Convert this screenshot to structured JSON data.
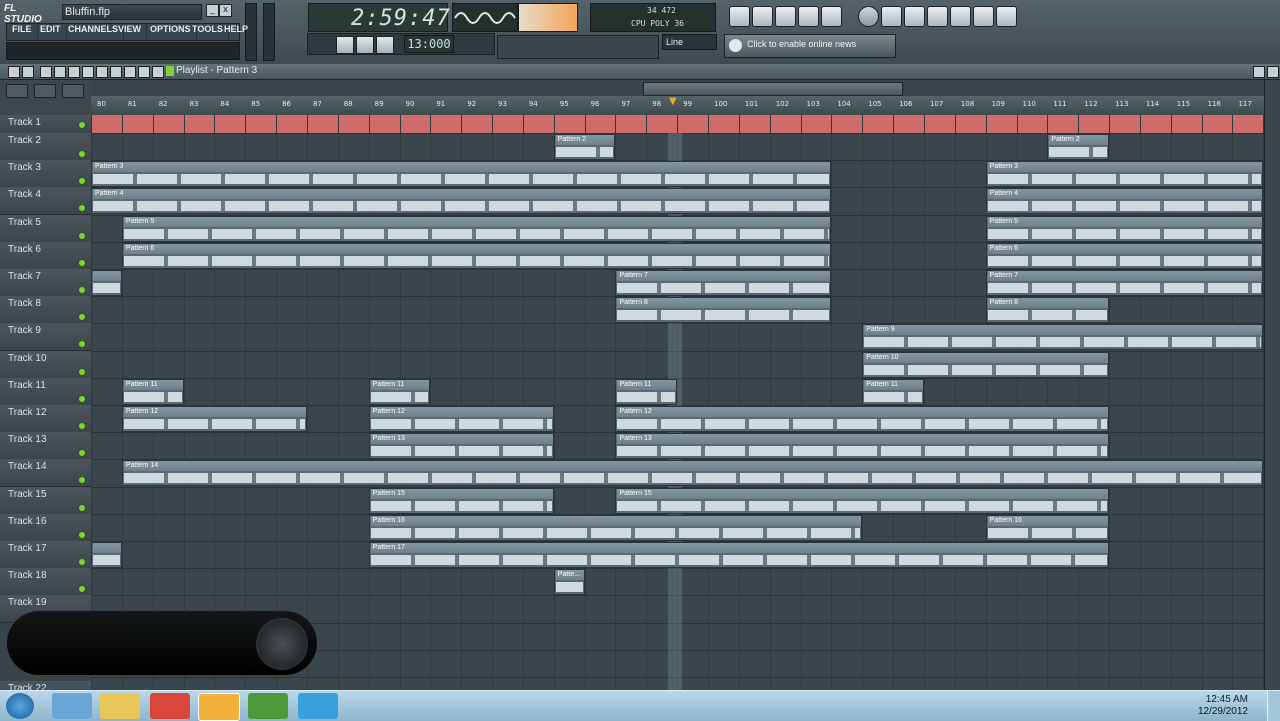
{
  "app": {
    "logo": "FL STUDIO",
    "filename": "Bluffin.flp",
    "menu": [
      "FILE",
      "EDIT",
      "CHANNELS",
      "VIEW",
      "OPTIONS",
      "TOOLS",
      "HELP"
    ]
  },
  "transport": {
    "time": "2:59:47",
    "counter": "13:000",
    "snap": "Line",
    "monitor_l1": "34  472",
    "monitor_l2": "CPU  POLY  36"
  },
  "news": {
    "text": "Click to enable online news"
  },
  "playlist": {
    "title": "Playlist - Pattern 3",
    "ruler_ticks": [
      "80",
      "81",
      "82",
      "83",
      "84",
      "85",
      "86",
      "87",
      "88",
      "89",
      "90",
      "91",
      "92",
      "93",
      "94",
      "95",
      "96",
      "97",
      "98",
      "99",
      "100",
      "101",
      "102",
      "103",
      "104",
      "105",
      "106",
      "107",
      "108",
      "109",
      "110",
      "111",
      "112",
      "113",
      "114",
      "115",
      "116",
      "117"
    ],
    "tracks": [
      "Track 1",
      "Track 2",
      "Track 3",
      "Track 4",
      "Track 5",
      "Track 6",
      "Track 7",
      "Track 8",
      "Track 9",
      "Track 10",
      "Track 11",
      "Track 12",
      "Track 13",
      "Track 14",
      "Track 15",
      "Track 16",
      "Track 17",
      "Track 18",
      "Track 19",
      "Track 22"
    ],
    "clips": [
      {
        "t": 2,
        "start": 15,
        "len": 2,
        "label": "Pattern 2"
      },
      {
        "t": 2,
        "start": 31,
        "len": 2,
        "label": "Pattern 2"
      },
      {
        "t": 3,
        "start": 0,
        "len": 24,
        "label": "Pattern 3"
      },
      {
        "t": 3,
        "start": 29,
        "len": 9,
        "label": "Pattern 3"
      },
      {
        "t": 4,
        "start": 0,
        "len": 24,
        "label": "Pattern 4"
      },
      {
        "t": 4,
        "start": 29,
        "len": 9,
        "label": "Pattern 4"
      },
      {
        "t": 5,
        "start": 1,
        "len": 23,
        "label": "Pattern 5"
      },
      {
        "t": 5,
        "start": 29,
        "len": 9,
        "label": "Pattern 5"
      },
      {
        "t": 6,
        "start": 1,
        "len": 23,
        "label": "Pattern 6"
      },
      {
        "t": 6,
        "start": 29,
        "len": 9,
        "label": "Pattern 6"
      },
      {
        "t": 7,
        "start": 0,
        "len": 1,
        "label": ""
      },
      {
        "t": 7,
        "start": 17,
        "len": 7,
        "label": "Pattern 7"
      },
      {
        "t": 7,
        "start": 29,
        "len": 9,
        "label": "Pattern 7"
      },
      {
        "t": 8,
        "start": 17,
        "len": 7,
        "label": "Pattern 8"
      },
      {
        "t": 8,
        "start": 29,
        "len": 4,
        "label": "Pattern 8"
      },
      {
        "t": 9,
        "start": 25,
        "len": 13,
        "label": "Pattern 9"
      },
      {
        "t": 10,
        "start": 25,
        "len": 8,
        "label": "Pattern 10"
      },
      {
        "t": 11,
        "start": 1,
        "len": 2,
        "label": "Pattern 11"
      },
      {
        "t": 11,
        "start": 9,
        "len": 2,
        "label": "Pattern 11"
      },
      {
        "t": 11,
        "start": 17,
        "len": 2,
        "label": "Pattern 11"
      },
      {
        "t": 11,
        "start": 25,
        "len": 2,
        "label": "Pattern 11"
      },
      {
        "t": 12,
        "start": 1,
        "len": 6,
        "label": "Pattern 12"
      },
      {
        "t": 12,
        "start": 9,
        "len": 6,
        "label": "Pattern 12"
      },
      {
        "t": 12,
        "start": 17,
        "len": 16,
        "label": "Pattern 12"
      },
      {
        "t": 13,
        "start": 9,
        "len": 6,
        "label": "Pattern 13"
      },
      {
        "t": 13,
        "start": 17,
        "len": 16,
        "label": "Pattern 13"
      },
      {
        "t": 14,
        "start": 1,
        "len": 37,
        "label": "Pattern 14"
      },
      {
        "t": 15,
        "start": 9,
        "len": 6,
        "label": "Pattern 15"
      },
      {
        "t": 15,
        "start": 17,
        "len": 16,
        "label": "Pattern 15"
      },
      {
        "t": 16,
        "start": 9,
        "len": 16,
        "label": "Pattern 16"
      },
      {
        "t": 16,
        "start": 29,
        "len": 4,
        "label": "Pattern 16"
      },
      {
        "t": 17,
        "start": 0,
        "len": 1,
        "label": ""
      },
      {
        "t": 17,
        "start": 9,
        "len": 24,
        "label": "Pattern 17"
      },
      {
        "t": 18,
        "start": 15,
        "len": 1,
        "label": "Patte..."
      }
    ]
  },
  "taskbar": {
    "time": "12:45 AM",
    "date": "12/29/2012",
    "apps": [
      "ie-icon",
      "explorer-icon",
      "chrome-icon",
      "flstudio-icon",
      "utorrent-icon",
      "skype-icon"
    ]
  }
}
